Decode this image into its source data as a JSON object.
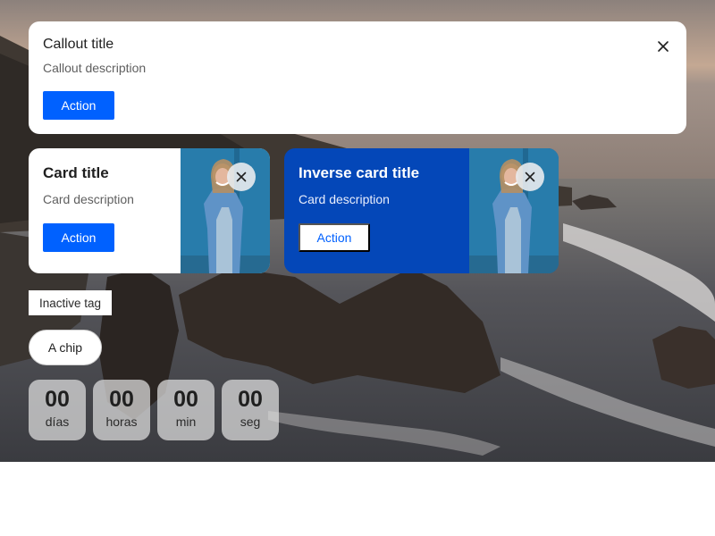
{
  "callout": {
    "title": "Callout title",
    "description": "Callout description",
    "action_label": "Action",
    "close_icon": "close-icon"
  },
  "cards": [
    {
      "variant": "light",
      "title": "Card title",
      "description": "Card description",
      "action_label": "Action",
      "media": "person-in-denim-jacket-photo",
      "close_icon": "close-icon"
    },
    {
      "variant": "inverse",
      "title": "Inverse card title",
      "description": "Card description",
      "action_label": "Action",
      "media": "person-in-denim-jacket-photo",
      "close_icon": "close-icon"
    }
  ],
  "tag": {
    "label": "Inactive tag",
    "state": "inactive"
  },
  "chip": {
    "label": "A chip"
  },
  "countdown": [
    {
      "value": "00",
      "unit": "días"
    },
    {
      "value": "00",
      "unit": "horas"
    },
    {
      "value": "00",
      "unit": "min"
    },
    {
      "value": "00",
      "unit": "seg"
    }
  ],
  "colors": {
    "primary": "#0061ff",
    "inverse_card": "#0447b8",
    "surface": "#ffffff",
    "text": "#1f1f1f",
    "muted_text": "#5f5f5f",
    "countdown_bg": "#e0e0e0"
  },
  "background": "sunset-rocky-coast-photo"
}
